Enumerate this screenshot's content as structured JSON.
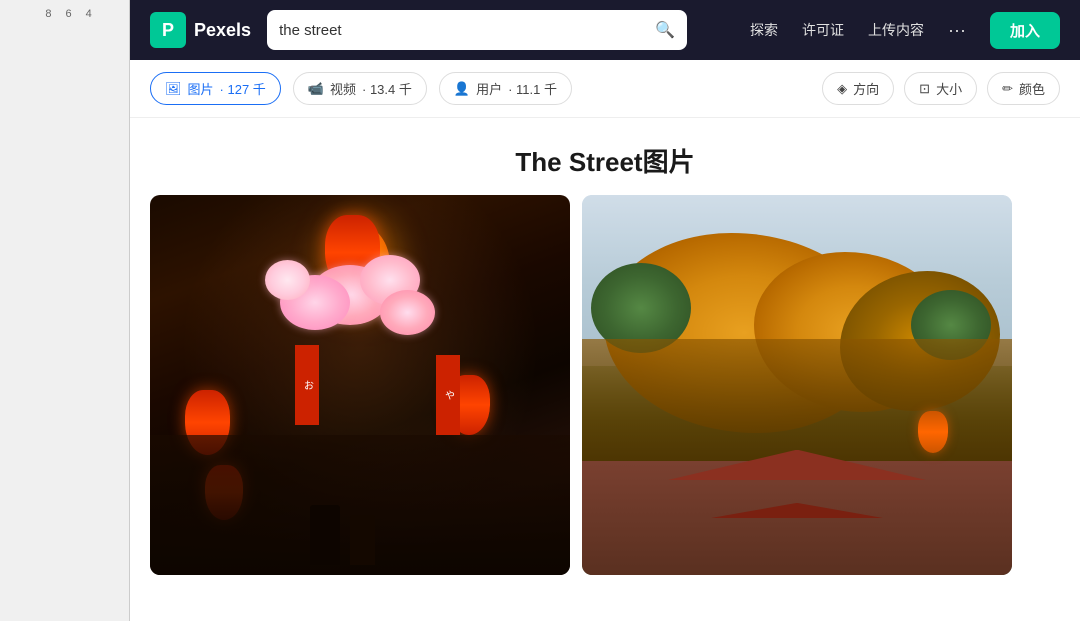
{
  "ruler": {
    "numbers": [
      "8",
      "6",
      "4"
    ]
  },
  "navbar": {
    "logo_letter": "P",
    "logo_label": "Pexels",
    "search_value": "the street",
    "search_placeholder": "the street",
    "nav_links": [
      {
        "id": "explore",
        "label": "探索"
      },
      {
        "id": "license",
        "label": "许可证"
      },
      {
        "id": "upload",
        "label": "上传内容"
      }
    ],
    "more_label": "···",
    "join_label": "加入"
  },
  "filter_bar": {
    "tabs": [
      {
        "id": "photos",
        "label": "图片",
        "count": "127 千",
        "icon": "🖼",
        "active": true
      },
      {
        "id": "videos",
        "label": "视频",
        "count": "13.4 千",
        "icon": "🎥",
        "active": false
      },
      {
        "id": "users",
        "label": "用户",
        "count": "11.1 千",
        "icon": "👤",
        "active": false
      }
    ],
    "filters": [
      {
        "id": "direction",
        "label": "方向",
        "icon": "◈"
      },
      {
        "id": "size",
        "label": "大小",
        "icon": "⊡"
      },
      {
        "id": "color",
        "label": "颜色",
        "icon": "✏"
      }
    ]
  },
  "page": {
    "title": "The Street图片"
  },
  "photos": [
    {
      "id": "photo-1",
      "alt": "Japanese street with cherry blossoms and red lanterns"
    },
    {
      "id": "photo-2",
      "alt": "Autumn trees with orange foliage on a street"
    }
  ],
  "colors": {
    "navbar_bg": "#1a1a2e",
    "logo_green": "#00c896",
    "active_blue": "#1a6ef5",
    "join_green": "#00c896"
  }
}
